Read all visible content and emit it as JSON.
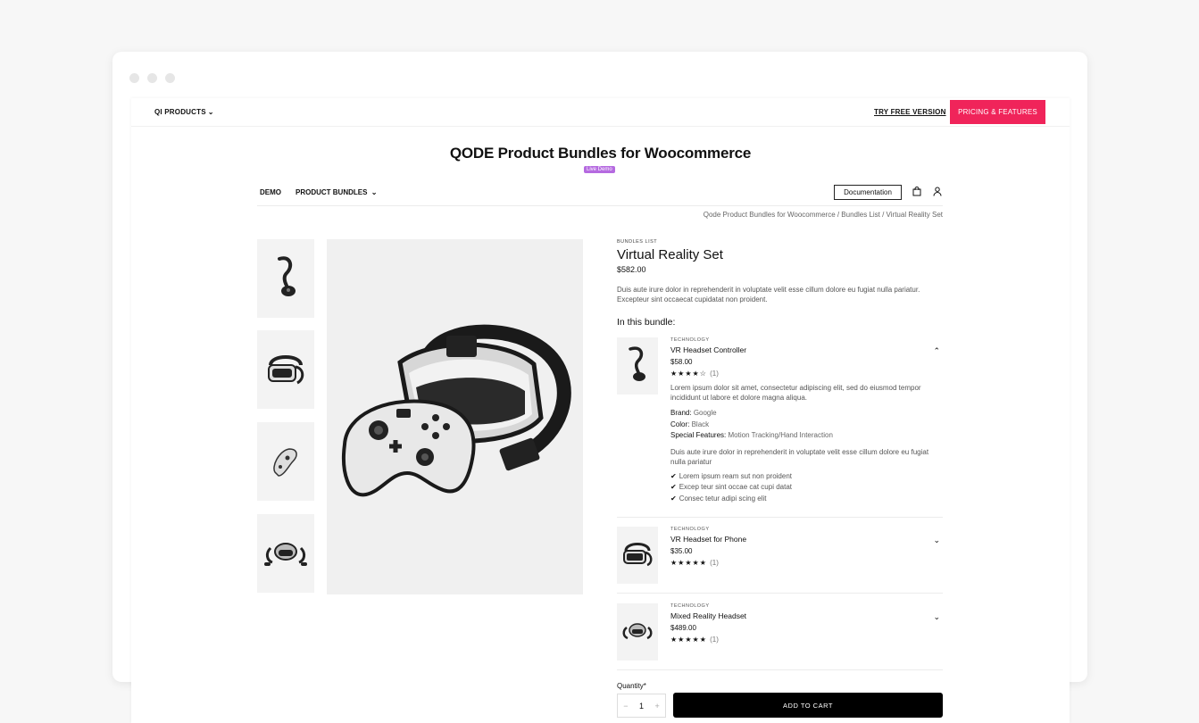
{
  "topbar": {
    "products_label": "QI PRODUCTS",
    "try_free_label": "TRY FREE VERSION",
    "pricing_label": "PRICING & FEATURES"
  },
  "page_title": "QODE Product Bundles for Woocommerce",
  "live_badge": "Live Demo",
  "demo_nav": {
    "demo_label": "DEMO",
    "bundles_label": "PRODUCT BUNDLES",
    "documentation_label": "Documentation"
  },
  "breadcrumb": "Qode Product Bundles for Woocommerce  /  Bundles List  /  Virtual Reality Set",
  "product": {
    "category": "BUNDLES LIST",
    "title": "Virtual Reality Set",
    "price": "$582.00",
    "description": "Duis aute irure dolor in reprehenderit in voluptate velit esse cillum dolore eu fugiat nulla pariatur. Excepteur sint occaecat cupidatat non proident.",
    "bundle_heading": "In this bundle:"
  },
  "bundle_items": [
    {
      "category": "TECHNOLOGY",
      "name": "VR Headset Controller",
      "price": "$58.00",
      "stars": "★★★★☆",
      "rating_count": "(1)",
      "expanded": true,
      "description": "Lorem ipsum dolor sit amet, consectetur adipiscing elit, sed do eiusmod tempor incididunt ut labore et dolore magna aliqua.",
      "specs": [
        {
          "key": "Brand:",
          "value": "Google"
        },
        {
          "key": "Color:",
          "value": "Black"
        },
        {
          "key": "Special Features:",
          "value": "Motion Tracking/Hand Interaction"
        }
      ],
      "extra": "Duis aute irure dolor in reprehenderit in voluptate velit esse cillum dolore eu fugiat nulla pariatur",
      "checks": [
        "Lorem ipsum ream sut non proident",
        "Excep teur sint occae cat cupi datat",
        "Consec tetur adipi scing elit"
      ]
    },
    {
      "category": "TECHNOLOGY",
      "name": "VR Headset for Phone",
      "price": "$35.00",
      "stars": "★★★★★",
      "rating_count": "(1)",
      "expanded": false
    },
    {
      "category": "TECHNOLOGY",
      "name": "Mixed Reality Headset",
      "price": "$489.00",
      "stars": "★★★★★",
      "rating_count": "(1)",
      "expanded": false
    }
  ],
  "cart": {
    "quantity_label": "Quantity*",
    "quantity": "1",
    "minus": "−",
    "plus": "+",
    "add_label": "ADD TO CART"
  }
}
